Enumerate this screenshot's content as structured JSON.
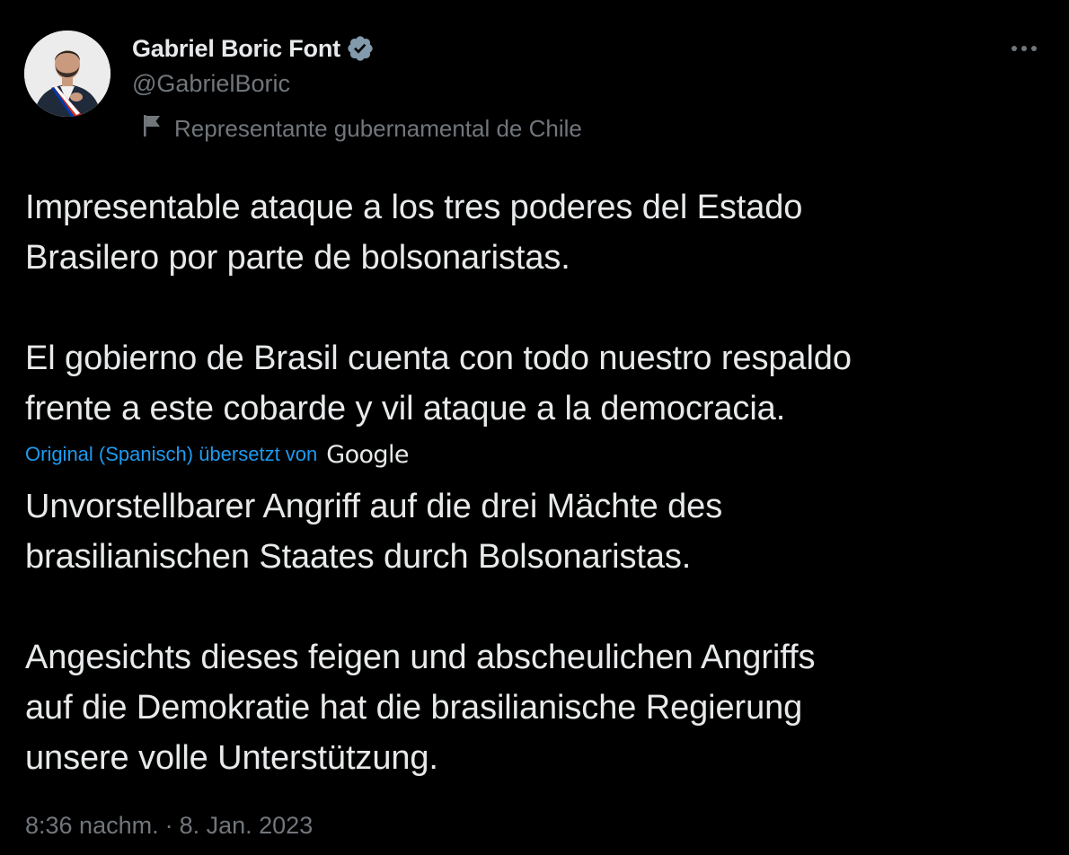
{
  "author": {
    "name": "Gabriel Boric Font",
    "handle": "@GabrielBoric",
    "label": "Representante gubernamental de Chile",
    "verified_icon": "verified-badge-icon"
  },
  "tweet": {
    "original": [
      [
        "Impresentable ataque a los tres poderes del Estado",
        "Brasilero por parte de bolsonaristas."
      ],
      [
        "El gobierno de Brasil cuenta con todo nuestro respaldo",
        "frente a este cobarde y vil ataque a la democracia."
      ]
    ],
    "translation_note": "Original (Spanisch) übersetzt von",
    "translation_provider": "Google",
    "translated": [
      [
        "Unvorstellbarer Angriff auf die drei Mächte des",
        "brasilianischen Staates durch Bolsonaristas."
      ],
      [
        "Angesichts dieses feigen und abscheulichen Angriffs",
        "auf die Demokratie hat die brasilianische Regierung",
        "unsere volle Unterstützung."
      ]
    ],
    "time": "8:36 nachm.",
    "separator": "·",
    "date": "8. Jan. 2023"
  },
  "colors": {
    "background": "#000000",
    "primary_text": "#e7e9ea",
    "secondary_text": "#71767b",
    "link": "#1d9bf0",
    "verified": "#829aab"
  },
  "icons": {
    "more": "more-options-icon",
    "flag": "flag-icon"
  }
}
